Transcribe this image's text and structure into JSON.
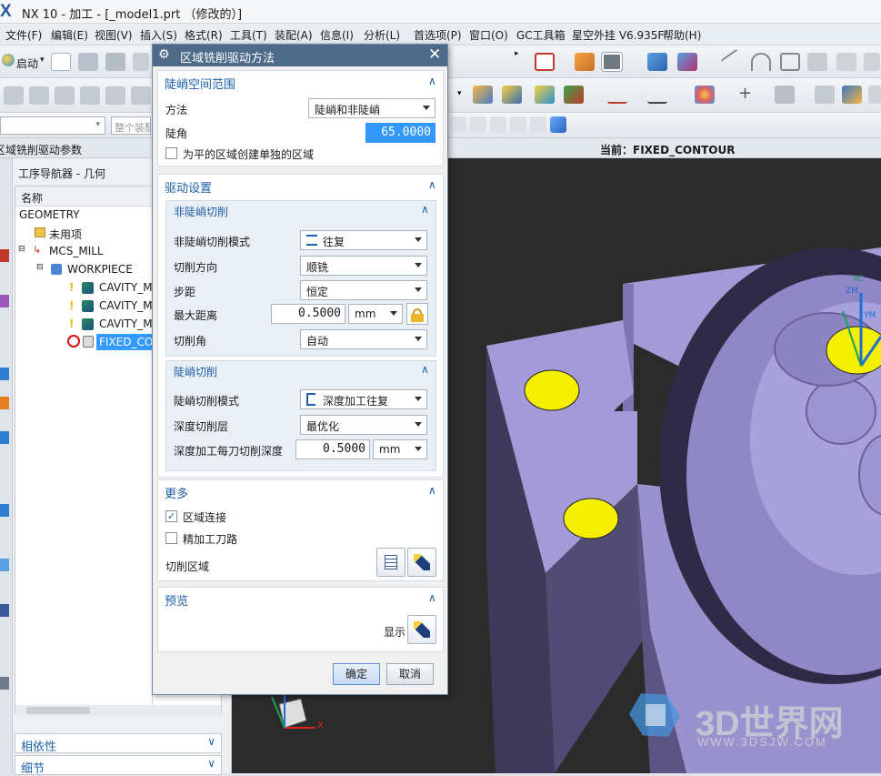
{
  "window": {
    "title": "NX 10 - 加工 - [_model1.prt （修改的）]",
    "logo": "X"
  },
  "menu": [
    "文件(F)",
    "编辑(E)",
    "视图(V)",
    "插入(S)",
    "格式(R)",
    "工具(T)",
    "装配(A)",
    "信息(I)",
    "分析(L)",
    "首选项(P)",
    "窗口(O)",
    "GC工具箱",
    "星空外挂 V6.935F",
    "帮助(H)"
  ],
  "toolbar": {
    "start_label": "启动",
    "filter_placeholder": "整个装配"
  },
  "navigator": {
    "panel_title": "区域铣削驱动参数",
    "heading": "工序导航器 - 几何",
    "column_name": "名称",
    "rows": [
      "GEOMETRY",
      "未用项",
      "MCS_MILL",
      "WORKPIECE",
      "CAVITY_M",
      "CAVITY_M",
      "CAVITY_M",
      "FIXED_CO"
    ],
    "bottom_panels": [
      "相依性",
      "细节"
    ]
  },
  "viewport": {
    "current_label": "当前：FIXED_CONTOUR",
    "axis_labels": [
      "ZM",
      "XC",
      "YM"
    ],
    "triad_x": "X"
  },
  "watermark": {
    "brand": "3D世界网",
    "url": "WWW.3DSJW.COM"
  },
  "dialog": {
    "title": "区域铣削驱动方法",
    "steep_group": {
      "title": "陡峭空间范围",
      "method_label": "方法",
      "method_value": "陡峭和非陡峭",
      "angle_label": "陡角",
      "angle_value": "65.0000",
      "flat_checkbox_label": "为平的区域创建单独的区域",
      "flat_checked": false
    },
    "drive_group": {
      "title": "驱动设置",
      "nonsteep": {
        "title": "非陡峭切削",
        "mode_label": "非陡峭切削模式",
        "mode_value": "往复",
        "direction_label": "切削方向",
        "direction_value": "顺铣",
        "stepover_label": "步距",
        "stepover_value": "恒定",
        "maxdist_label": "最大距离",
        "maxdist_value": "0.5000",
        "maxdist_unit": "mm",
        "angle_label": "切削角",
        "angle_value": "自动"
      },
      "steep": {
        "title": "陡峭切削",
        "mode_label": "陡峭切削模式",
        "mode_value": "深度加工往复",
        "level_label": "深度切削层",
        "level_value": "最优化",
        "depth_label": "深度加工每刀切削深度",
        "depth_value": "0.5000",
        "depth_unit": "mm"
      }
    },
    "more_group": {
      "title": "更多",
      "region_connect_label": "区域连接",
      "region_connect_checked": true,
      "finish_label": "精加工刀路",
      "finish_checked": false,
      "cut_region_label": "切削区域"
    },
    "preview_group": {
      "title": "预览",
      "show_label": "显示"
    },
    "ok_label": "确定",
    "cancel_label": "取消"
  },
  "colors": {
    "accent": "#1d5fa8",
    "dialog_title": "#4d6b89",
    "model": "#9b93cf",
    "highlight": "#f5ef00",
    "selection": "#3399ff"
  }
}
